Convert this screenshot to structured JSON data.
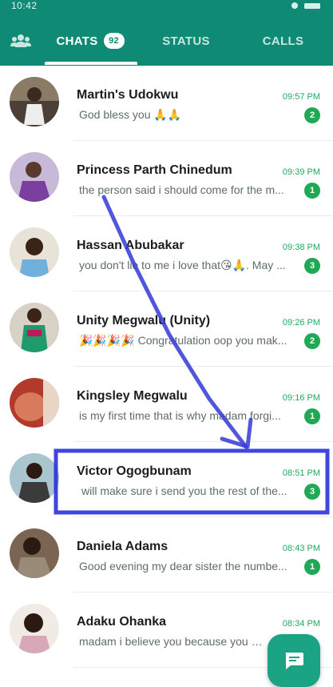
{
  "status_bar": {
    "time": "10:42"
  },
  "tabs": {
    "community_icon": "community-icon",
    "chats_label": "CHATS",
    "chats_badge": "92",
    "status_label": "STATUS",
    "calls_label": "CALLS"
  },
  "chats": [
    {
      "name": "Martin's Udokwu",
      "message": "God bless you 🙏🙏",
      "time": "09:57 PM",
      "unread": "2"
    },
    {
      "name": "Princess Parth Chinedum",
      "message": "the person said i should come for the m...",
      "time": "09:39 PM",
      "unread": "1"
    },
    {
      "name": "Hassan Abubakar",
      "message": "you don't lie to me i love that😘🙏. May ...",
      "time": "09:38 PM",
      "unread": "3"
    },
    {
      "name": "Unity Megwalu (Unity)",
      "message": "🎉🎉🎉🎉 Congratulation oop you mak...",
      "time": "09:26 PM",
      "unread": "2"
    },
    {
      "name": "Kingsley Megwalu",
      "message": "is my first time that is why madam forgi...",
      "time": "09:16 PM",
      "unread": "1"
    },
    {
      "name": "Victor Ogogbunam",
      "message": "will make sure i send you the rest of the...",
      "time": "08:51 PM",
      "unread": "3"
    },
    {
      "name": "Daniela Adams",
      "message": "Good evening my dear sister the numbe...",
      "time": "08:43 PM",
      "unread": "1"
    },
    {
      "name": "Adaku Ohanka",
      "message": "madam i believe you because you a...",
      "time": "08:34 PM",
      "unread": ""
    }
  ],
  "fab": {
    "icon": "new-chat-icon"
  },
  "colors": {
    "header": "#0f8a74",
    "accent_green": "#1fa855",
    "annotation_blue": "#3a3fd6"
  }
}
